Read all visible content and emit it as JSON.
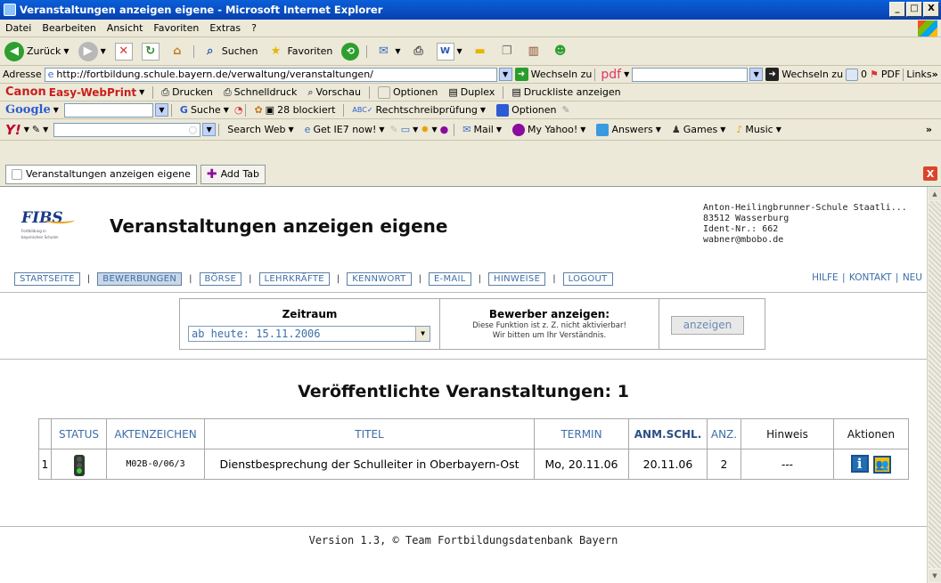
{
  "window": {
    "title": "Veranstaltungen anzeigen eigene - Microsoft Internet Explorer",
    "min": "_",
    "max": "□",
    "close": "X"
  },
  "menu": [
    "Datei",
    "Bearbeiten",
    "Ansicht",
    "Favoriten",
    "Extras",
    "?"
  ],
  "nav": {
    "back": "Zurück",
    "search": "Suchen",
    "favorites": "Favoriten"
  },
  "address": {
    "label": "Adresse",
    "url": "http://fortbildung.schule.bayern.de/verwaltung/veranstaltungen/",
    "go": "Wechseln zu",
    "pdf": "pdf",
    "go2": "Wechseln zu",
    "count": "0",
    "pdfbtn": "PDF",
    "links": "Links"
  },
  "canon": {
    "brand": "Canon",
    "product": "Easy-WebPrint",
    "print": "Drucken",
    "quick": "Schnelldruck",
    "preview": "Vorschau",
    "options": "Optionen",
    "duplex": "Duplex",
    "printlist": "Druckliste anzeigen"
  },
  "google": {
    "label": "Google",
    "search": "Suche",
    "blocked": "28 blockiert",
    "spell": "Rechtschreibprüfung",
    "options": "Optionen"
  },
  "yahoo": {
    "label": "Y!",
    "searchweb": "Search Web",
    "getie": "Get IE7 now!",
    "mail": "Mail",
    "myyahoo": "My Yahoo!",
    "answers": "Answers",
    "games": "Games",
    "music": "Music"
  },
  "tabs": {
    "current": "Veranstaltungen anzeigen eigene",
    "add": "Add Tab",
    "close": "X"
  },
  "page": {
    "title": "Veranstaltungen anzeigen eigene",
    "logo": "FIBS",
    "logo_sub1": "Fortbildung in",
    "logo_sub2": "bayerischen Schulen",
    "school": [
      "Anton-Heilingbrunner-Schule Staatli...",
      "83512 Wasserburg",
      "Ident-Nr.: 662",
      "wabner@mbobo.de"
    ],
    "nav": [
      "STARTSEITE",
      "BEWERBUNGEN",
      "BÖRSE",
      "LEHRKRÄFTE",
      "KENNWORT",
      "E-MAIL",
      "HINWEISE",
      "LOGOUT"
    ],
    "rightnav": [
      "HILFE",
      "KONTAKT",
      "NEU"
    ],
    "filter": {
      "zeitraum_label": "Zeitraum",
      "zeitraum_value": "ab heute: 15.11.2006",
      "bewerber_label": "Bewerber anzeigen:",
      "bewerber_note1": "Diese Funktion ist z. Z. nicht aktivierbar!",
      "bewerber_note2": "Wir bitten um Ihr Verständnis.",
      "button": "anzeigen"
    },
    "heading": "Veröffentlichte Veranstaltungen: 1",
    "table": {
      "headers": [
        "",
        "STATUS",
        "AKTENZEICHEN",
        "TITEL",
        "TERMIN",
        "ANM.SCHL.",
        "ANZ.",
        "Hinweis",
        "Aktionen"
      ],
      "rows": [
        {
          "nr": "1",
          "aktenzeichen": "M02B-0/06/3",
          "titel": "Dienstbesprechung der Schulleiter in Oberbayern-Ost",
          "termin": "Mo, 20.11.06",
          "anmschl": "20.11.06",
          "anz": "2",
          "hinweis": "---"
        }
      ]
    },
    "footer": "Version 1.3, © Team Fortbildungsdatenbank Bayern"
  }
}
